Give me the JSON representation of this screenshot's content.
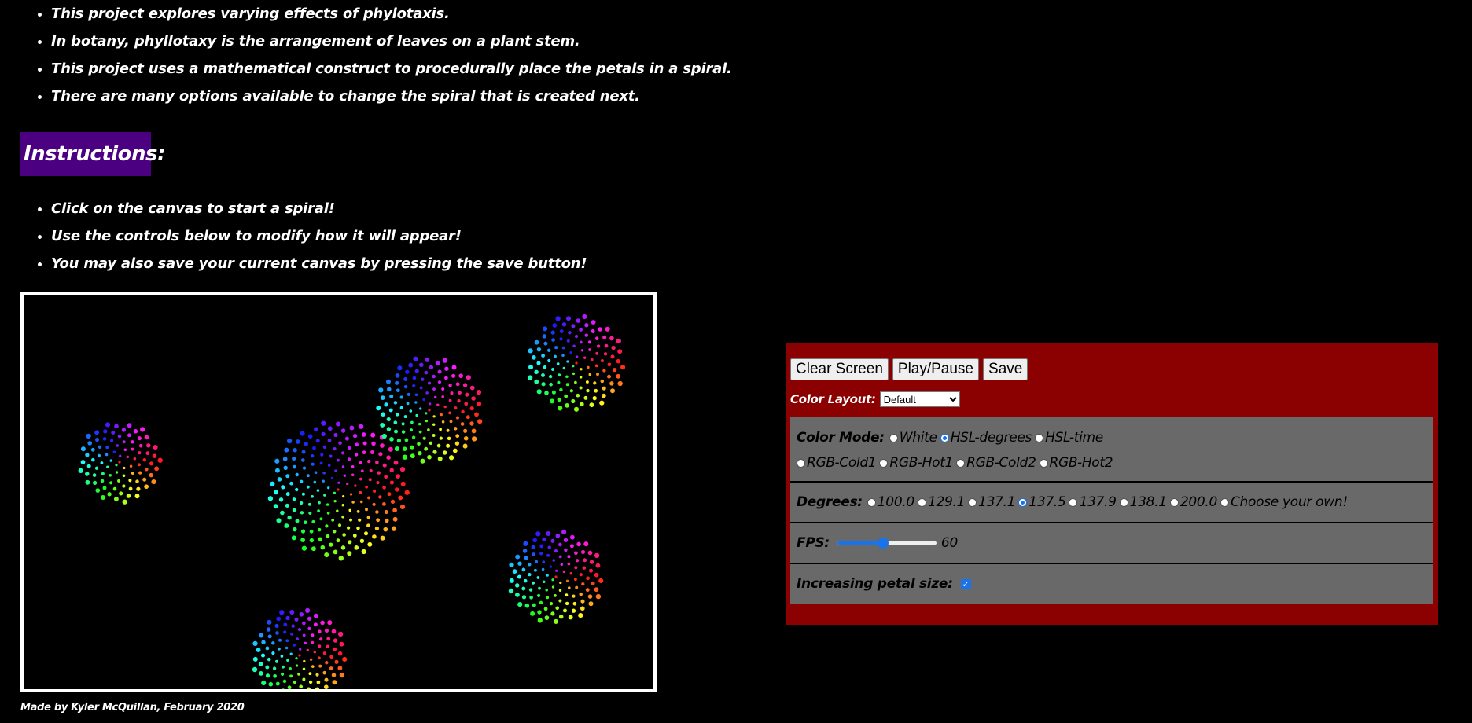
{
  "intro": [
    "This project explores varying effects of phylotaxis.",
    "In botany, phyllotaxy is the arrangement of leaves on a plant stem.",
    "This project uses a mathematical construct to procedurally place the petals in a spiral.",
    "There are many options available to change the spiral that is created next."
  ],
  "instructions_heading": "Instructions:",
  "instructions": [
    "Click on the canvas to start a spiral!",
    "Use the controls below to modify how it will appear!",
    "You may also save your current canvas by pressing the save button!"
  ],
  "footer": "Made by Kyler McQuillan, February 2020",
  "controls": {
    "buttons": {
      "clear": "Clear Screen",
      "play": "Play/Pause",
      "save": "Save"
    },
    "color_layout": {
      "label": "Color Layout:",
      "selected": "Default"
    },
    "color_mode": {
      "label": "Color Mode:",
      "options": [
        "White",
        "HSL-degrees",
        "HSL-time",
        "RGB-Cold1",
        "RGB-Hot1",
        "RGB-Cold2",
        "RGB-Hot2"
      ],
      "selected": "HSL-degrees"
    },
    "degrees": {
      "label": "Degrees:",
      "options": [
        "100.0",
        "129.1",
        "137.1",
        "137.5",
        "137.9",
        "138.1",
        "200.0",
        "Choose your own!"
      ],
      "selected": "137.5"
    },
    "fps": {
      "label": "FPS:",
      "value": "60",
      "fraction": 0.46
    },
    "petal_size": {
      "label": "Increasing petal size:",
      "checked": true
    }
  },
  "canvas": {
    "angle_degrees": 137.5,
    "spirals": [
      {
        "count": 90
      },
      {
        "count": 200
      },
      {
        "count": 140
      },
      {
        "count": 120
      },
      {
        "count": 120
      },
      {
        "count": 120
      }
    ]
  }
}
